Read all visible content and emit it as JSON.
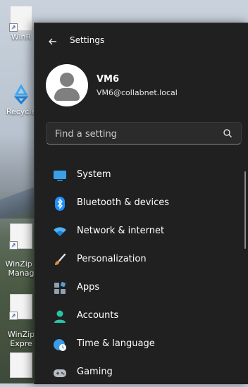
{
  "desktop": {
    "icons": [
      {
        "label": "WinR",
        "icon": "file-icon"
      },
      {
        "label": "Recycle",
        "icon": "recycle-bin-icon"
      },
      {
        "label": "WinZip I\nManag",
        "icon": "file-icon"
      },
      {
        "label": "WinZip\nExpre",
        "icon": "file-icon"
      }
    ]
  },
  "window": {
    "title": "Settings",
    "back_icon": "back-arrow-icon"
  },
  "profile": {
    "name": "VM6",
    "email": "VM6@collabnet.local"
  },
  "search": {
    "placeholder": "Find a setting",
    "icon": "search-icon"
  },
  "nav": {
    "items": [
      {
        "label": "System",
        "icon": "system-icon",
        "color": "#3aa0e8"
      },
      {
        "label": "Bluetooth & devices",
        "icon": "bluetooth-icon",
        "color": "#1e90ff"
      },
      {
        "label": "Network & internet",
        "icon": "wifi-icon",
        "color": "#4fb3f6"
      },
      {
        "label": "Personalization",
        "icon": "brush-icon",
        "color": "#e08a3c"
      },
      {
        "label": "Apps",
        "icon": "apps-icon",
        "color": "#8fa0b3"
      },
      {
        "label": "Accounts",
        "icon": "accounts-icon",
        "color": "#2bc3a5"
      },
      {
        "label": "Time & language",
        "icon": "globe-clock-icon",
        "color": "#3b9be6"
      },
      {
        "label": "Gaming",
        "icon": "gamepad-icon",
        "color": "#b7bcc4"
      }
    ]
  }
}
